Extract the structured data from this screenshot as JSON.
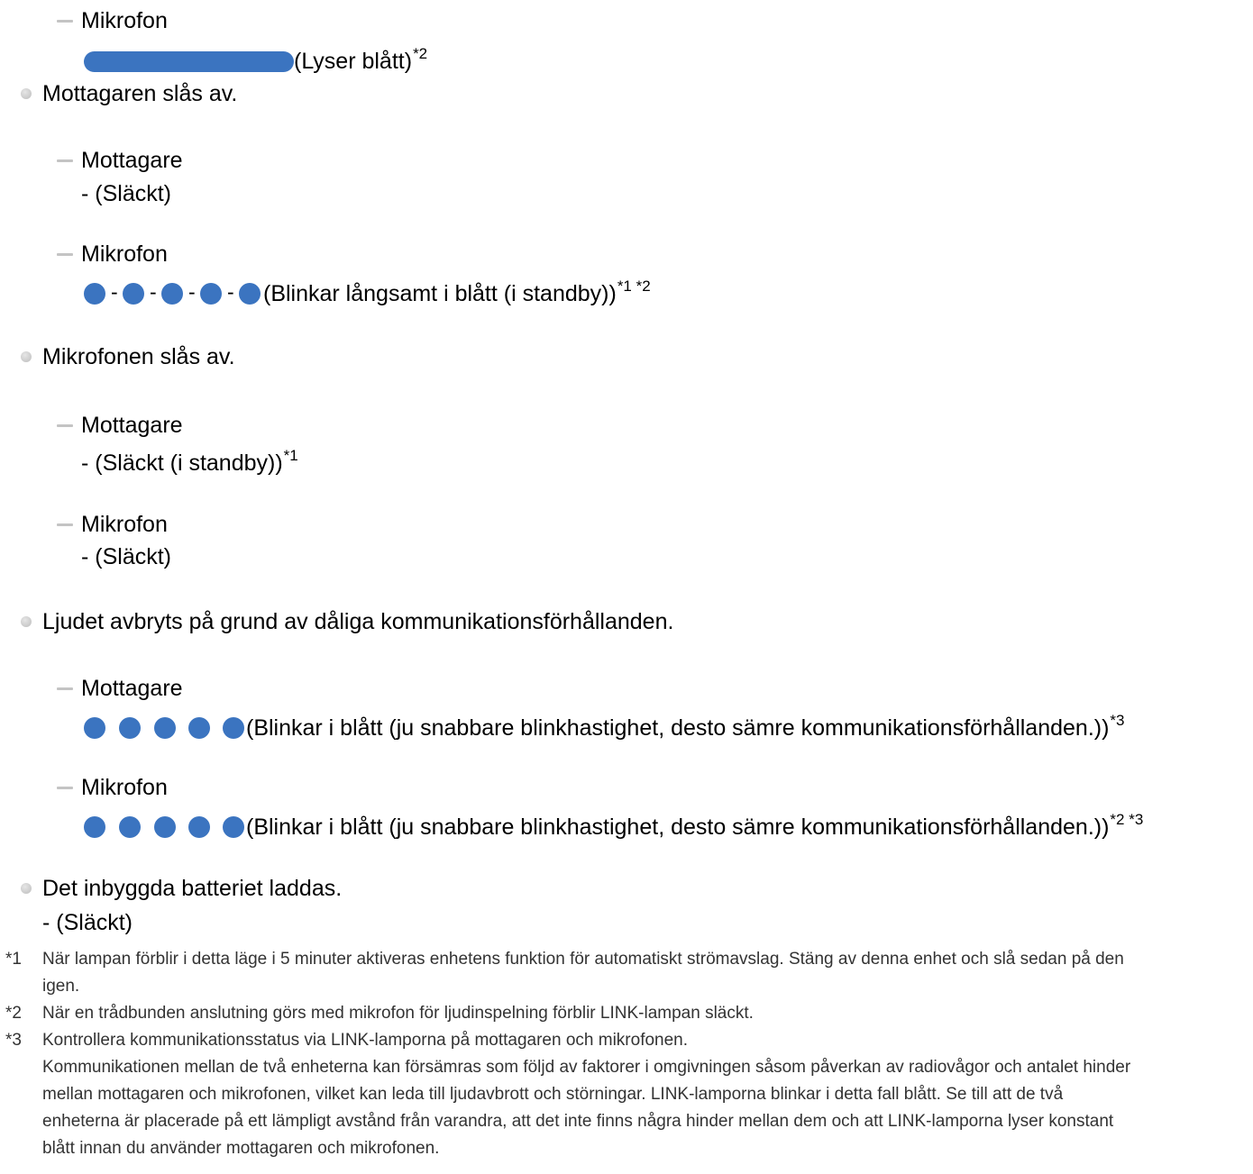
{
  "items": {
    "mic1_label": "Mikrofon",
    "mic1_status": "(Lyser blått)",
    "mic1_sup": "*2",
    "s1_heading": "Mottagaren slås av.",
    "s1_rec_label": "Mottagare",
    "s1_rec_status": "- (Släckt)",
    "s1_mic_label": "Mikrofon",
    "s1_mic_status": "(Blinkar långsamt i blått (i standby))",
    "s1_mic_sup": "*1 *2",
    "dash_sep": "-",
    "s2_heading": "Mikrofonen slås av.",
    "s2_rec_label": "Mottagare",
    "s2_rec_status": "- (Släckt (i standby))",
    "s2_rec_sup": "*1",
    "s2_mic_label": "Mikrofon",
    "s2_mic_status": "- (Släckt)",
    "s3_heading": "Ljudet avbryts på grund av dåliga kommunikationsförhållanden.",
    "s3_rec_label": "Mottagare",
    "s3_rec_status": "(Blinkar i blått (ju snabbare blinkhastighet, desto sämre kommunikationsförhållanden.))",
    "s3_rec_sup": "*3",
    "s3_mic_label": "Mikrofon",
    "s3_mic_status": "(Blinkar i blått (ju snabbare blinkhastighet, desto sämre kommunikationsförhållanden.))",
    "s3_mic_sup": "*2 *3",
    "s4_heading": "Det inbyggda batteriet laddas.",
    "s4_status": "- (Släckt)"
  },
  "footnotes": [
    {
      "mark": "*1",
      "lines": [
        "När lampan förblir i detta läge i 5 minuter aktiveras enhetens funktion för automatiskt strömavslag. Stäng av denna enhet och slå sedan på den",
        "igen."
      ]
    },
    {
      "mark": "*2",
      "lines": [
        "När en trådbunden anslutning görs med mikrofon för ljudinspelning förblir LINK-lampan släckt."
      ]
    },
    {
      "mark": "*3",
      "lines": [
        "Kontrollera kommunikationsstatus via LINK-lamporna på mottagaren och mikrofonen.",
        "Kommunikationen mellan de två enheterna kan försämras som följd av faktorer i omgivningen såsom påverkan av radiovågor och antalet hinder",
        "mellan mottagaren och mikrofonen, vilket kan leda till ljudavbrott och störningar. LINK-lamporna blinkar i detta fall blått. Se till att de två",
        "enheterna är placerade på ett lämpligt avstånd från varandra, att det inte finns några hinder mellan dem och att LINK-lamporna lyser konstant",
        "blått innan du använder mottagaren och mikrofonen."
      ]
    }
  ],
  "colors": {
    "led_blue": "#3b74c0",
    "bullet_gray": "#c4c4c4",
    "footnote_text": "#333333"
  }
}
